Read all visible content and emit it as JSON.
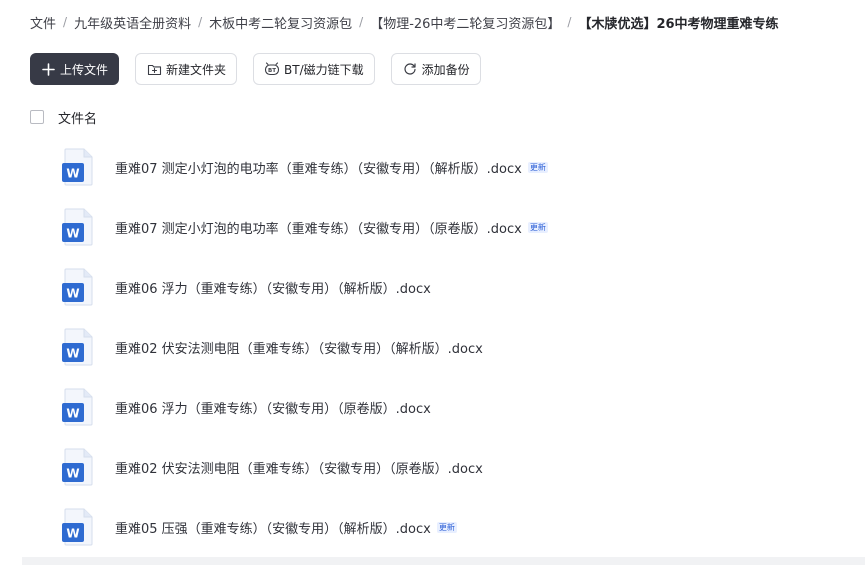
{
  "breadcrumb": {
    "items": [
      "文件",
      "九年级英语全册资料",
      "木板中考二轮复习资源包",
      "【物理-26中考二轮复习资源包】",
      "【木牍优选】26中考物理重难专练"
    ],
    "separator": "/"
  },
  "toolbar": {
    "upload_label": "上传文件",
    "new_folder_label": "新建文件夹",
    "bt_download_label": "BT/磁力链下载",
    "add_backup_label": "添加备份"
  },
  "list": {
    "header_label": "文件名",
    "files": [
      {
        "name": "重难07 测定小灯泡的电功率（重难专练）（安徽专用）（解析版）.docx",
        "badge": "更新"
      },
      {
        "name": "重难07 测定小灯泡的电功率（重难专练）（安徽专用）（原卷版）.docx",
        "badge": "更新"
      },
      {
        "name": "重难06 浮力（重难专练）（安徽专用）（解析版）.docx",
        "badge": ""
      },
      {
        "name": "重难02 伏安法测电阻（重难专练）（安徽专用）（解析版）.docx",
        "badge": ""
      },
      {
        "name": "重难06 浮力（重难专练）（安徽专用）（原卷版）.docx",
        "badge": ""
      },
      {
        "name": "重难02 伏安法测电阻（重难专练）（安徽专用）（原卷版）.docx",
        "badge": ""
      },
      {
        "name": "重难05 压强（重难专练）（安徽专用）（解析版）.docx",
        "badge": "更新"
      }
    ]
  },
  "icons": {
    "file_type": "word-doc-icon",
    "file_letter": "W"
  },
  "colors": {
    "primary_button": "#373a46",
    "word_blue": "#2f6bd1",
    "badge_text": "#2c5fd6",
    "badge_bg": "#e8efff"
  }
}
